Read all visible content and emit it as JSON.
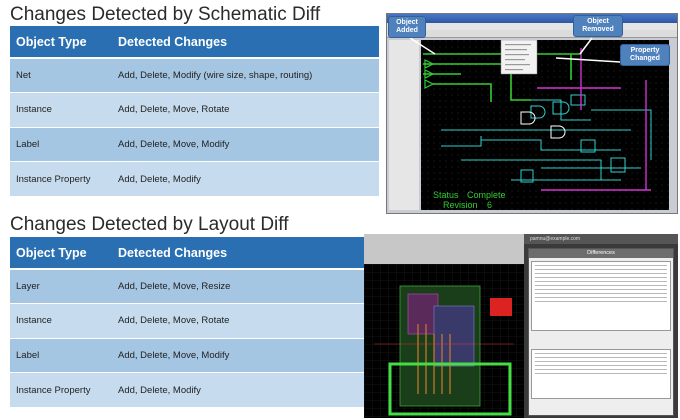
{
  "schematic_section": {
    "title": "Changes Detected by Schematic Diff",
    "headers": [
      "Object Type",
      "Detected Changes"
    ],
    "rows": [
      {
        "type": "Net",
        "changes": "Add, Delete, Modify (wire size, shape, routing)"
      },
      {
        "type": "Instance",
        "changes": "Add, Delete, Move, Rotate"
      },
      {
        "type": "Label",
        "changes": "Add, Delete, Move, Modify"
      },
      {
        "type": "Instance Property",
        "changes": "Add, Delete, Modify"
      }
    ]
  },
  "layout_section": {
    "title": "Changes Detected by Layout Diff",
    "headers": [
      "Object Type",
      "Detected Changes"
    ],
    "rows": [
      {
        "type": "Layer",
        "changes": "Add, Delete, Move, Resize"
      },
      {
        "type": "Instance",
        "changes": "Add, Delete, Move, Rotate"
      },
      {
        "type": "Label",
        "changes": "Add, Delete, Move, Modify"
      },
      {
        "type": "Instance Property",
        "changes": "Add, Delete, Modify"
      }
    ]
  },
  "schematic_screenshot": {
    "callouts": {
      "object_added": "Object Added",
      "object_removed": "Object Removed",
      "property_changed": "Property Changed"
    },
    "status_label": "Status",
    "status_value": "Complete",
    "revision_label": "Revision",
    "revision_value": "6"
  },
  "layout_screenshot": {
    "window_title": "Differences",
    "host": "pamnu@example.com"
  },
  "colors": {
    "table_header": "#2a6fb2",
    "row_light": "#c6dcee",
    "row_dark": "#a4c6e2",
    "callout": "#4f81bd",
    "schematic_green": "#33cc33",
    "schematic_cyan": "#2fd0d0",
    "schematic_magenta": "#d432d4"
  }
}
